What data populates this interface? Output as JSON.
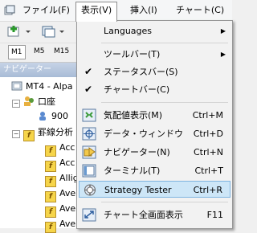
{
  "menubar": {
    "items": [
      "ファイル(F)",
      "表示(V)",
      "挿入(I)",
      "チャート(C)"
    ]
  },
  "timeframes": [
    "M1",
    "M5",
    "M15"
  ],
  "navigator": {
    "title": "ナビゲーター",
    "root": "MT4 - Alpa",
    "accounts": "口座",
    "account_number": "900",
    "indicators": "罫線分析",
    "items": [
      "Acc",
      "Acc",
      "Allig",
      "Ave",
      "Ave",
      "Ave"
    ]
  },
  "view_menu": {
    "items": [
      {
        "label": "Languages",
        "shortcut": "",
        "submenu": true
      },
      {
        "label": "ツールバー(T)",
        "shortcut": "",
        "submenu": true
      },
      {
        "label": "ステータスバー(S)",
        "shortcut": "",
        "checked": true
      },
      {
        "label": "チャートバー(C)",
        "shortcut": "",
        "checked": true
      },
      {
        "label": "気配値表示(M)",
        "shortcut": "Ctrl+M",
        "icon": "market-watch-icon"
      },
      {
        "label": "データ・ウィンドウ",
        "shortcut": "Ctrl+D",
        "icon": "crosshair-icon"
      },
      {
        "label": "ナビゲーター(N)",
        "shortcut": "Ctrl+N",
        "icon": "navigator-icon"
      },
      {
        "label": "ターミナル(T)",
        "shortcut": "Ctrl+T",
        "icon": "terminal-icon"
      },
      {
        "label": "Strategy Tester",
        "shortcut": "Ctrl+R",
        "icon": "strategy-tester-icon",
        "highlighted": true
      },
      {
        "label": "チャート全画面表示",
        "shortcut": "F11",
        "icon": "fullscreen-icon"
      }
    ]
  }
}
